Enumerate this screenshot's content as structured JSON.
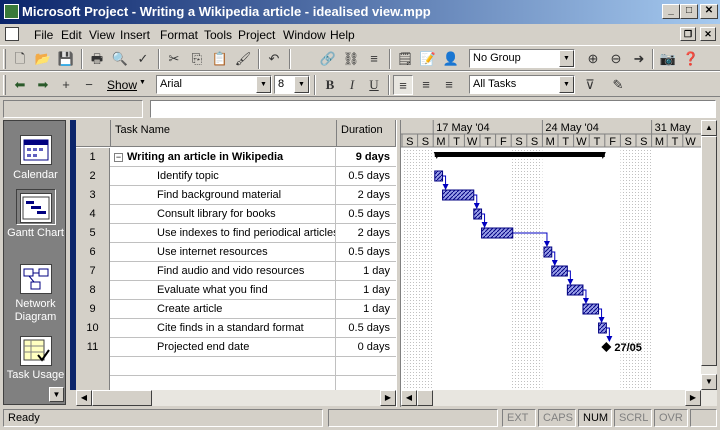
{
  "window": {
    "title": "Microsoft Project - Writing a Wikipedia article - idealised view.mpp"
  },
  "menu": [
    "File",
    "Edit",
    "View",
    "Insert",
    "Format",
    "Tools",
    "Project",
    "Window",
    "Help"
  ],
  "toolbar": {
    "group_value": "No Group",
    "show_label": "Show",
    "font_value": "Arial",
    "size_value": "8",
    "filter_value": "All Tasks",
    "bold": "B",
    "italic": "I",
    "underline": "U"
  },
  "viewbar": {
    "items": [
      {
        "label": "Calendar"
      },
      {
        "label": "Gantt Chart",
        "selected": true
      },
      {
        "label": "Network Diagram"
      },
      {
        "label": "Task Usage"
      }
    ]
  },
  "table": {
    "columns": [
      "Task Name",
      "Duration"
    ],
    "rows": [
      {
        "id": "1",
        "name": "Writing an article in Wikipedia",
        "duration": "9 days",
        "summary": true
      },
      {
        "id": "2",
        "name": "Identify topic",
        "duration": "0.5 days"
      },
      {
        "id": "3",
        "name": "Find background material",
        "duration": "2 days"
      },
      {
        "id": "4",
        "name": "Consult library for books",
        "duration": "0.5 days"
      },
      {
        "id": "5",
        "name": "Use indexes to find periodical articles",
        "duration": "2 days"
      },
      {
        "id": "6",
        "name": "Use internet resources",
        "duration": "0.5 days"
      },
      {
        "id": "7",
        "name": "Find audio and vido resources",
        "duration": "1 day"
      },
      {
        "id": "8",
        "name": "Evaluate what you find",
        "duration": "1 day"
      },
      {
        "id": "9",
        "name": "Create article",
        "duration": "1 day"
      },
      {
        "id": "10",
        "name": "Cite finds in a standard format",
        "duration": "0.5 days"
      },
      {
        "id": "11",
        "name": "Projected end date",
        "duration": "0 days",
        "milestone": true
      }
    ]
  },
  "gantt": {
    "weeks": [
      "17 May '04",
      "24 May '04",
      "31 May"
    ],
    "days": [
      "S",
      "S",
      "M",
      "T",
      "W",
      "T",
      "F",
      "S",
      "S",
      "M",
      "T",
      "W",
      "T",
      "F",
      "S",
      "S",
      "M",
      "T",
      "W"
    ],
    "milestone_label": "27/05",
    "bars": [
      {
        "row": 1,
        "start": 2.1,
        "end": 13.0,
        "summary": true
      },
      {
        "row": 2,
        "start": 2.1,
        "end": 2.6
      },
      {
        "row": 3,
        "start": 2.6,
        "end": 4.6
      },
      {
        "row": 4,
        "start": 4.6,
        "end": 5.1
      },
      {
        "row": 5,
        "start": 5.1,
        "end": 7.1
      },
      {
        "row": 6,
        "start": 9.1,
        "end": 9.6
      },
      {
        "row": 7,
        "start": 9.6,
        "end": 10.6
      },
      {
        "row": 8,
        "start": 10.6,
        "end": 11.6
      },
      {
        "row": 9,
        "start": 11.6,
        "end": 12.6
      },
      {
        "row": 10,
        "start": 12.6,
        "end": 13.1
      },
      {
        "row": 11,
        "start": 13.1,
        "end": 13.1,
        "milestone": true
      }
    ]
  },
  "status": {
    "ready": "Ready",
    "indicators": [
      "EXT",
      "CAPS",
      "NUM",
      "SCRL",
      "OVR"
    ],
    "active": [
      "NUM"
    ]
  }
}
